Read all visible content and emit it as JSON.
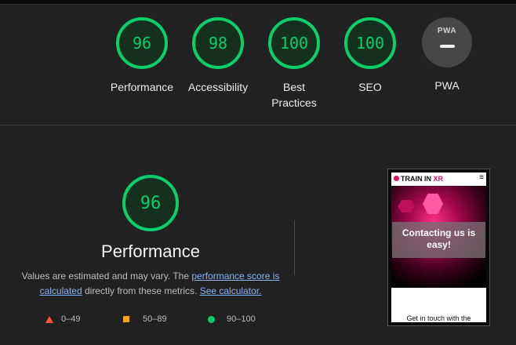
{
  "categories": [
    {
      "score": "96",
      "label": "Performance"
    },
    {
      "score": "98",
      "label": "Accessibility"
    },
    {
      "score": "100",
      "label": "Best Practices"
    },
    {
      "score": "100",
      "label": "SEO"
    }
  ],
  "pwa": {
    "badge_text": "PWA",
    "label": "PWA"
  },
  "performance": {
    "score": "96",
    "title": "Performance",
    "desc_prefix": "Values are estimated and may vary. The ",
    "desc_link1": "performance score is calculated",
    "desc_middle": " directly from these metrics. ",
    "desc_link2": "See calculator."
  },
  "legend": {
    "fail": "0–49",
    "average": "50–89",
    "pass": "90–100"
  },
  "colors": {
    "pass": "#0cce6b",
    "average": "#ffa400",
    "fail": "#ff4e42"
  },
  "screenshot": {
    "brand_prefix": "TRAIN IN ",
    "brand_accent": "XR",
    "menu_icon": "hamburger-icon",
    "hero_text": "Contacting us is easy!",
    "footer_text": "Get in touch with the"
  }
}
